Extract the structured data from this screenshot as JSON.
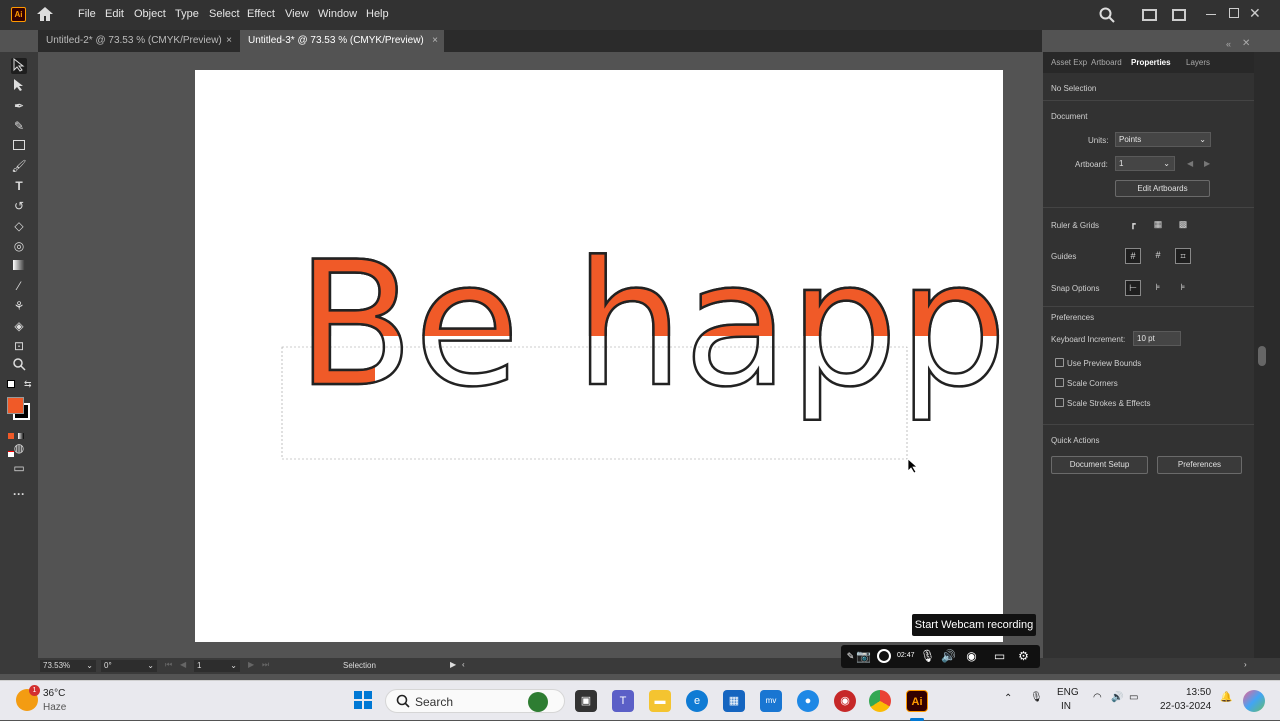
{
  "app": {
    "logo": "Ai",
    "menu": [
      "File",
      "Edit",
      "Object",
      "Type",
      "Select",
      "Effect",
      "View",
      "Window",
      "Help"
    ]
  },
  "tabs": [
    {
      "label": "Untitled-2* @ 73.53 % (CMYK/Preview)",
      "close": "×"
    },
    {
      "label": "Untitled-3* @ 73.53 % (CMYK/Preview)",
      "close": "×"
    }
  ],
  "artwork": {
    "text": "Be happy",
    "fill_color": "#f05a28",
    "stroke_color": "#222222"
  },
  "panel": {
    "tabs": [
      "Asset Exp",
      "Artboard",
      "Properties",
      "Layers"
    ],
    "no_selection": "No Selection",
    "document_heading": "Document",
    "units_label": "Units:",
    "units_value": "Points",
    "artboard_label": "Artboard:",
    "artboard_value": "1",
    "edit_artboards": "Edit Artboards",
    "ruler_grids": "Ruler & Grids",
    "guides": "Guides",
    "snap_options": "Snap Options",
    "preferences_heading": "Preferences",
    "keyboard_increment_label": "Keyboard Increment:",
    "keyboard_increment_value": "10 pt",
    "use_preview_bounds": "Use Preview Bounds",
    "scale_corners": "Scale Corners",
    "scale_strokes": "Scale Strokes & Effects",
    "quick_actions": "Quick Actions",
    "document_setup": "Document Setup",
    "preferences_button": "Preferences"
  },
  "status": {
    "zoom": "73.53%",
    "rotation": "0°",
    "artboard": "1",
    "tool": "Selection"
  },
  "recorder": {
    "time": "02:47",
    "tooltip": "Start Webcam recording"
  },
  "taskbar": {
    "weather_badge": "1",
    "temperature": "36°C",
    "condition": "Haze",
    "search_placeholder": "Search",
    "lang_line1": "ENG",
    "lang_line2": "IN",
    "time": "13:50",
    "date": "22-03-2024"
  }
}
